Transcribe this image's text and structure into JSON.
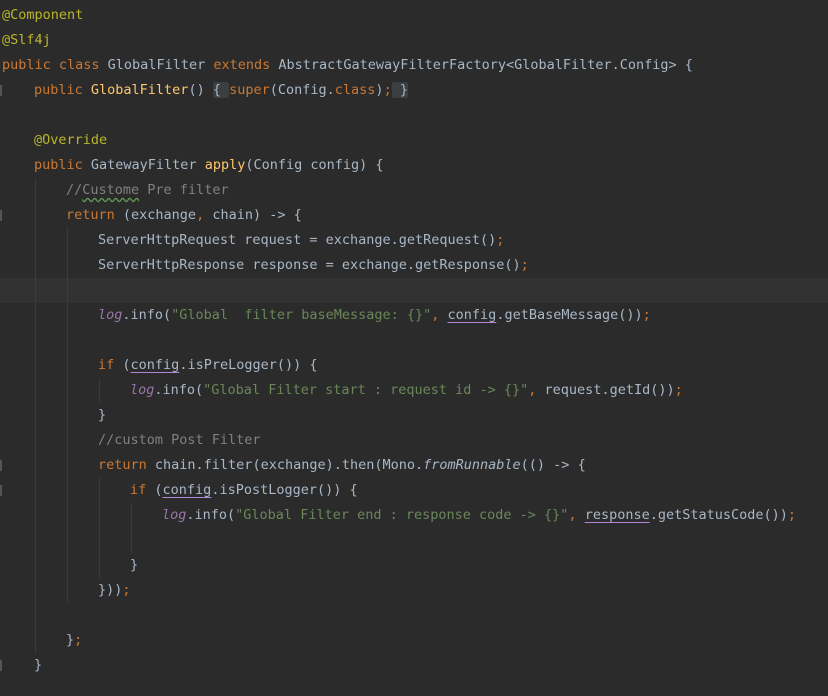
{
  "editor": {
    "language": "java",
    "theme": "darcula",
    "colors": {
      "background": "#2b2b2b",
      "current_line": "#323232",
      "keyword": "#cc7832",
      "annotation": "#bbb529",
      "method_declaration": "#ffc66d",
      "string": "#6a8759",
      "comment": "#808080",
      "default_text": "#a9b7c6",
      "static_field": "#9876aa"
    },
    "lines": [
      {
        "indent": 0,
        "tokens": [
          [
            "an",
            "@Component"
          ]
        ]
      },
      {
        "indent": 0,
        "tokens": [
          [
            "an",
            "@Slf4j"
          ]
        ]
      },
      {
        "indent": 0,
        "tokens": [
          [
            "kw",
            "public class "
          ],
          [
            "df",
            "GlobalFilter "
          ],
          [
            "kw",
            "extends "
          ],
          [
            "df",
            "AbstractGatewayFilterFactory<GlobalFilter.Config> {"
          ]
        ]
      },
      {
        "indent": 1,
        "mark": true,
        "tokens": [
          [
            "kw",
            "public "
          ],
          [
            "fn",
            "GlobalFilter"
          ],
          [
            "df",
            "() "
          ],
          [
            "fold",
            "{ "
          ],
          [
            "kw",
            "super"
          ],
          [
            "df",
            "(Config."
          ],
          [
            "kw",
            "class"
          ],
          [
            "df",
            ")"
          ],
          [
            "pu",
            ";"
          ],
          [
            "fold",
            " }"
          ]
        ]
      },
      {
        "indent": 0,
        "tokens": []
      },
      {
        "indent": 1,
        "tokens": [
          [
            "an",
            "@Override"
          ]
        ]
      },
      {
        "indent": 1,
        "tokens": [
          [
            "kw",
            "public "
          ],
          [
            "df",
            "GatewayFilter "
          ],
          [
            "fn",
            "apply"
          ],
          [
            "df",
            "(Config config) {"
          ]
        ]
      },
      {
        "indent": 2,
        "tokens": [
          [
            "cm",
            "//"
          ],
          [
            "cm ty",
            "Custome"
          ],
          [
            "cm",
            " Pre filter"
          ]
        ]
      },
      {
        "indent": 2,
        "mark": true,
        "tokens": [
          [
            "kw",
            "return "
          ],
          [
            "df",
            "(exchange"
          ],
          [
            "pu",
            ", "
          ],
          [
            "df",
            "chain) -> {"
          ]
        ]
      },
      {
        "indent": 3,
        "tokens": [
          [
            "df",
            "ServerHttpRequest request = exchange.getRequest()"
          ],
          [
            "pu",
            ";"
          ]
        ]
      },
      {
        "indent": 3,
        "tokens": [
          [
            "df",
            "ServerHttpResponse response = exchange.getResponse()"
          ],
          [
            "pu",
            ";"
          ]
        ]
      },
      {
        "indent": 3,
        "current": true,
        "tokens": []
      },
      {
        "indent": 3,
        "tokens": [
          [
            "lg",
            "log"
          ],
          [
            "df",
            ".info("
          ],
          [
            "st",
            "\"Global  filter baseMessage: {}\""
          ],
          [
            "pu",
            ", "
          ],
          [
            "cp",
            "config"
          ],
          [
            "df",
            ".getBaseMessage())"
          ],
          [
            "pu",
            ";"
          ]
        ]
      },
      {
        "indent": 3,
        "tokens": []
      },
      {
        "indent": 3,
        "tokens": [
          [
            "kw",
            "if "
          ],
          [
            "df",
            "("
          ],
          [
            "cp",
            "config"
          ],
          [
            "df",
            ".isPreLogger()) {"
          ]
        ]
      },
      {
        "indent": 4,
        "tokens": [
          [
            "lg",
            "log"
          ],
          [
            "df",
            ".info("
          ],
          [
            "st",
            "\"Global Filter start : request id -> {}\""
          ],
          [
            "pu",
            ", "
          ],
          [
            "df",
            "request.getId())"
          ],
          [
            "pu",
            ";"
          ]
        ]
      },
      {
        "indent": 3,
        "tokens": [
          [
            "df",
            "}"
          ]
        ]
      },
      {
        "indent": 3,
        "tokens": [
          [
            "cm",
            "//custom Post Filter"
          ]
        ]
      },
      {
        "indent": 3,
        "mark": true,
        "tokens": [
          [
            "kw",
            "return "
          ],
          [
            "df",
            "chain.filter(exchange).then(Mono."
          ],
          [
            "df it",
            "fromRunnable"
          ],
          [
            "df",
            "(() -> {"
          ]
        ]
      },
      {
        "indent": 4,
        "mark": true,
        "tokens": [
          [
            "kw",
            "if "
          ],
          [
            "df",
            "("
          ],
          [
            "cp",
            "config"
          ],
          [
            "df",
            ".isPostLogger()) {"
          ]
        ]
      },
      {
        "indent": 5,
        "tokens": [
          [
            "lg",
            "log"
          ],
          [
            "df",
            ".info("
          ],
          [
            "st",
            "\"Global Filter end : response code -> {}\""
          ],
          [
            "pu",
            ", "
          ],
          [
            "cp",
            "response"
          ],
          [
            "df",
            ".getStatusCode())"
          ],
          [
            "pu",
            ";"
          ]
        ]
      },
      {
        "indent": 5,
        "tokens": []
      },
      {
        "indent": 4,
        "tokens": [
          [
            "df",
            "}"
          ]
        ]
      },
      {
        "indent": 3,
        "tokens": [
          [
            "df",
            "}))"
          ],
          [
            "pu",
            ";"
          ]
        ]
      },
      {
        "indent": 2,
        "tokens": []
      },
      {
        "indent": 2,
        "tokens": [
          [
            "df",
            "}"
          ],
          [
            "pu",
            ";"
          ]
        ]
      },
      {
        "indent": 1,
        "mark": true,
        "tokens": [
          [
            "df",
            "}"
          ]
        ]
      }
    ]
  }
}
